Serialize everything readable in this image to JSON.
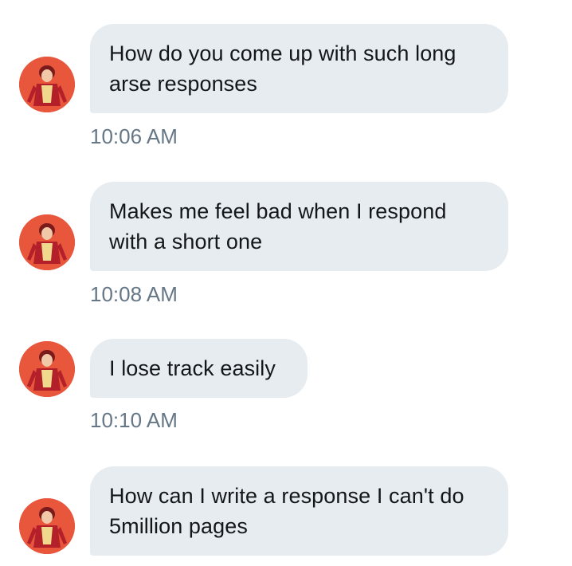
{
  "messages": [
    {
      "text": "How do you come up with such long arse responses",
      "time": "10:06 AM"
    },
    {
      "text": "Makes me feel bad when I respond with a short one",
      "time": "10:08 AM"
    },
    {
      "text": "I lose track easily",
      "time": "10:10 AM"
    },
    {
      "text": "How can I write a response I can't do 5million pages",
      "time": ""
    }
  ],
  "colors": {
    "bubble_bg": "#e6ecf0",
    "text": "#14171a",
    "timestamp": "#657786",
    "avatar_bg": "#e8533a"
  },
  "icons": {
    "avatar": "user-avatar-icon"
  }
}
